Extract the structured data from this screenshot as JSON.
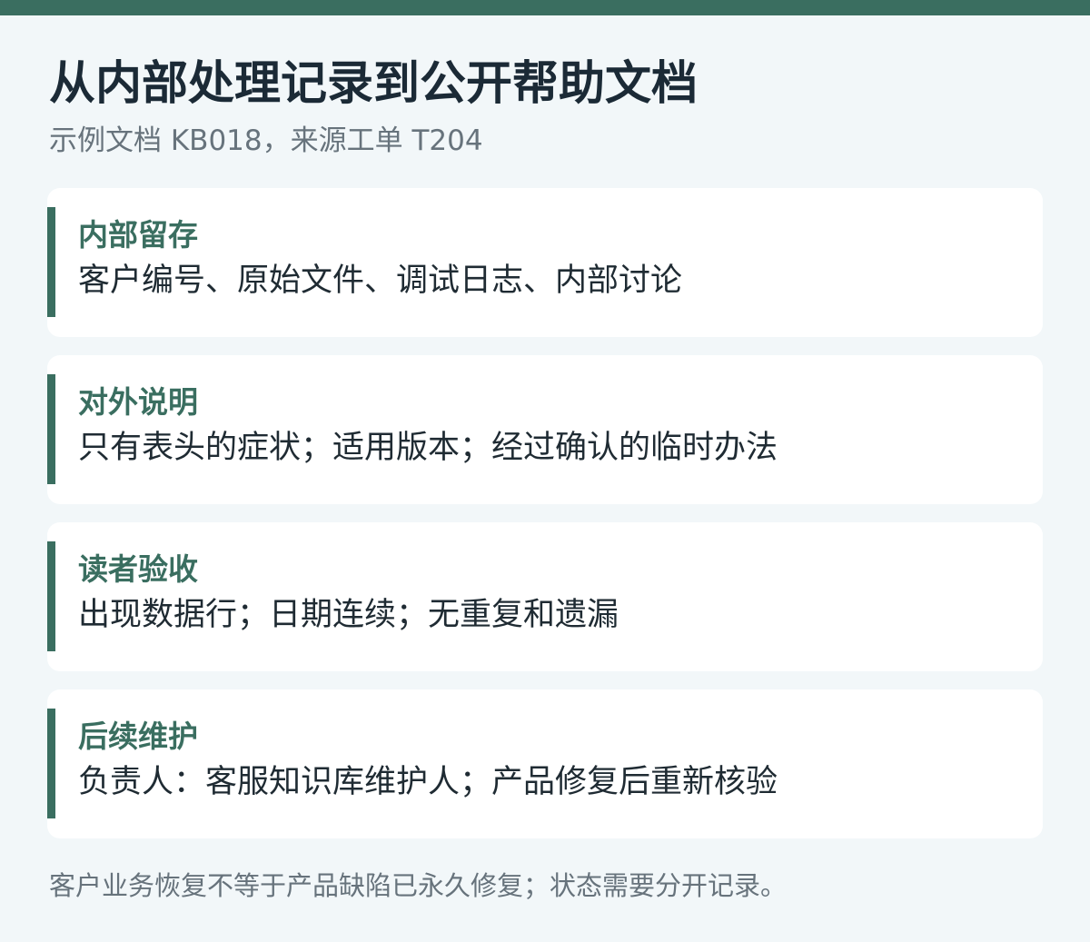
{
  "header": {
    "title": "从内部处理记录到公开帮助文档",
    "subtitle": "示例文档 KB018，来源工单 T204"
  },
  "sections": [
    {
      "title": "内部留存",
      "body": "客户编号、原始文件、调试日志、内部讨论"
    },
    {
      "title": "对外说明",
      "body": "只有表头的症状；适用版本；经过确认的临时办法"
    },
    {
      "title": "读者验收",
      "body": "出现数据行；日期连续；无重复和遗漏"
    },
    {
      "title": "后续维护",
      "body": "负责人：客服知识库维护人；产品修复后重新核验"
    }
  ],
  "footnote": "客户业务恢复不等于产品缺陷已永久修复；状态需要分开记录。",
  "colors": {
    "accent": "#3a6e60",
    "background": "#f2f7f9",
    "title_text": "#1b2a36",
    "muted_text": "#67737c"
  }
}
